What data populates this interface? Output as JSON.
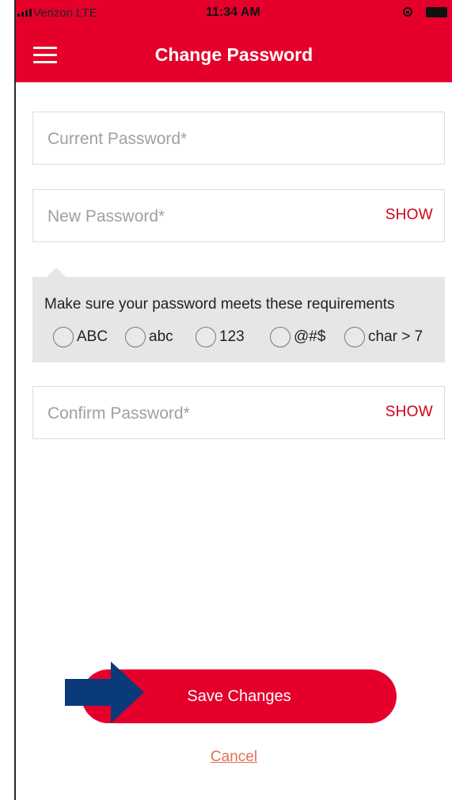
{
  "status_bar": {
    "carrier": "Verizon  LTE",
    "time": "11:34 AM"
  },
  "header": {
    "title": "Change Password",
    "menu_icon": "hamburger-menu-icon"
  },
  "form": {
    "current_password": {
      "placeholder": "Current Password*",
      "value": ""
    },
    "new_password": {
      "placeholder": "New Password*",
      "value": "",
      "show_label": "SHOW"
    },
    "confirm_password": {
      "placeholder": "Confirm Password*",
      "value": "",
      "show_label": "SHOW"
    }
  },
  "requirements": {
    "text": "Make sure your password meets these requirements",
    "items": [
      {
        "label": "ABC",
        "met": false
      },
      {
        "label": "abc",
        "met": false
      },
      {
        "label": "123",
        "met": false
      },
      {
        "label": "@#$",
        "met": false
      },
      {
        "label": "char > 7",
        "met": false
      }
    ]
  },
  "actions": {
    "save_label": "Save Changes",
    "cancel_label": "Cancel"
  },
  "colors": {
    "brand_red": "#e4002b",
    "link_red": "#d0021b",
    "cancel_link": "#e17055",
    "annotation_arrow": "#0b3a7a"
  }
}
